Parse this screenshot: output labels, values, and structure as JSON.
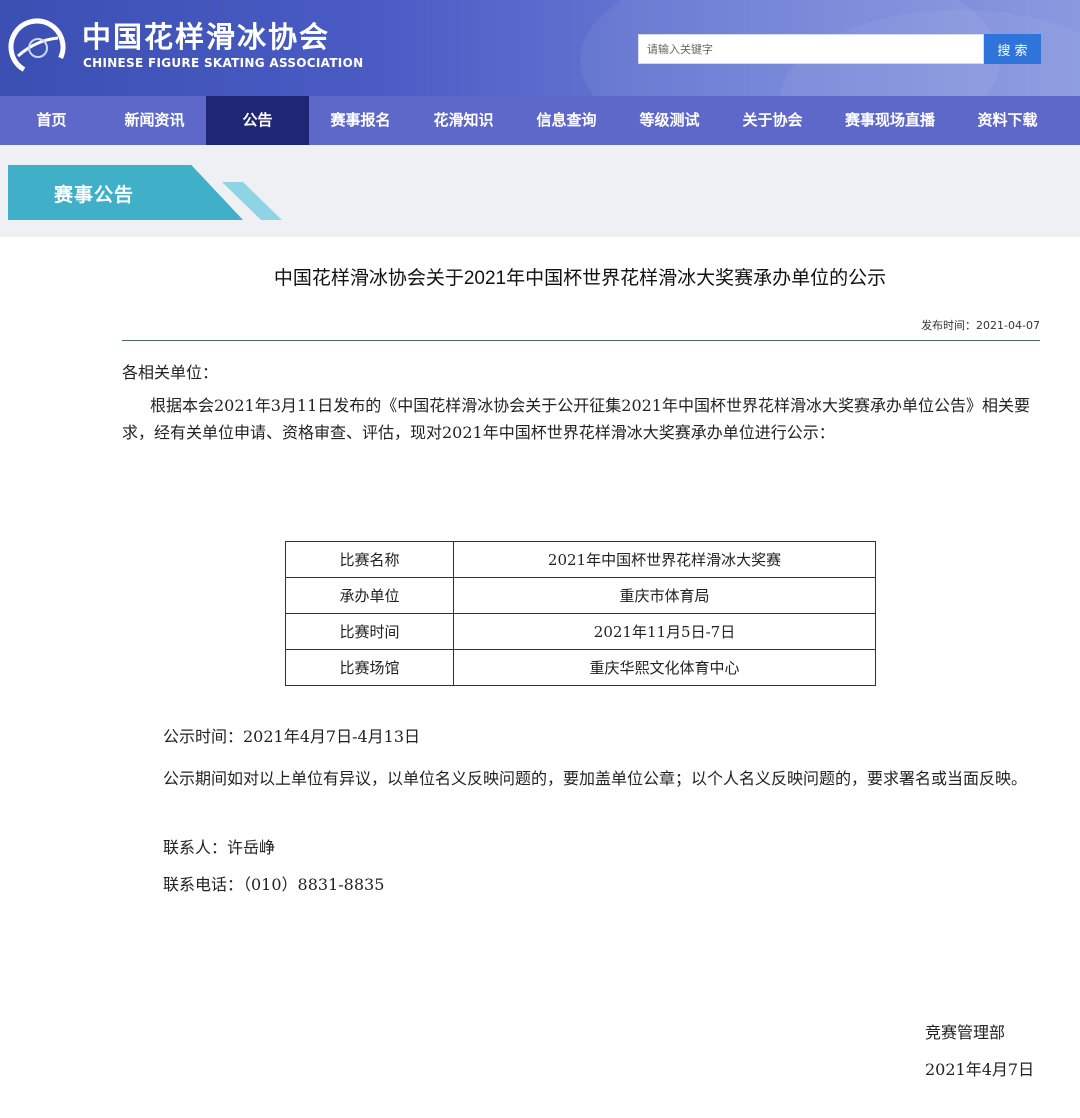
{
  "header": {
    "title": "中国花样滑冰协会",
    "subtitle": "CHINESE FIGURE SKATING ASSOCIATION",
    "search_placeholder": "请输入关键字",
    "search_button": "搜 索"
  },
  "nav": {
    "items": [
      {
        "label": "首页"
      },
      {
        "label": "新闻资讯"
      },
      {
        "label": "公告"
      },
      {
        "label": "赛事报名"
      },
      {
        "label": "花滑知识"
      },
      {
        "label": "信息查询"
      },
      {
        "label": "等级测试"
      },
      {
        "label": "关于协会"
      },
      {
        "label": "赛事现场直播"
      },
      {
        "label": "资料下载"
      }
    ],
    "active_index": 2
  },
  "section": {
    "label": "赛事公告"
  },
  "article": {
    "title": "中国花样滑冰协会关于2021年中国杯世界花样滑冰大奖赛承办单位的公示",
    "publish_time": "发布时间：2021-04-07",
    "salutation": "各相关单位：",
    "body": "根据本会2021年3月11日发布的《中国花样滑冰协会关于公开征集2021年中国杯世界花样滑冰大奖赛承办单位公告》相关要求，经有关单位申请、资格审查、评估，现对2021年中国杯世界花样滑冰大奖赛承办单位进行公示：",
    "table": [
      {
        "label": "比赛名称",
        "value": "2021年中国杯世界花样滑冰大奖赛"
      },
      {
        "label": "承办单位",
        "value": "重庆市体育局"
      },
      {
        "label": "比赛时间",
        "value": "2021年11月5日-7日"
      },
      {
        "label": "比赛场馆",
        "value": "重庆华熙文化体育中心"
      }
    ],
    "period": "公示时间：2021年4月7日-4月13日",
    "notice": "公示期间如对以上单位有异议，以单位名义反映问题的，要加盖单位公章；以个人名义反映问题的，要求署名或当面反映。",
    "contact": "联系人：许岳峥",
    "phone": "联系电话：（010）8831-8835",
    "department": "竞赛管理部",
    "date": "2021年4月7日"
  },
  "colors": {
    "header_blue": "#4a5cc4",
    "nav_blue": "#5d68c9",
    "nav_active": "#1f2673",
    "banner_teal": "#3fb0c8",
    "search_button": "#2f74d9"
  }
}
